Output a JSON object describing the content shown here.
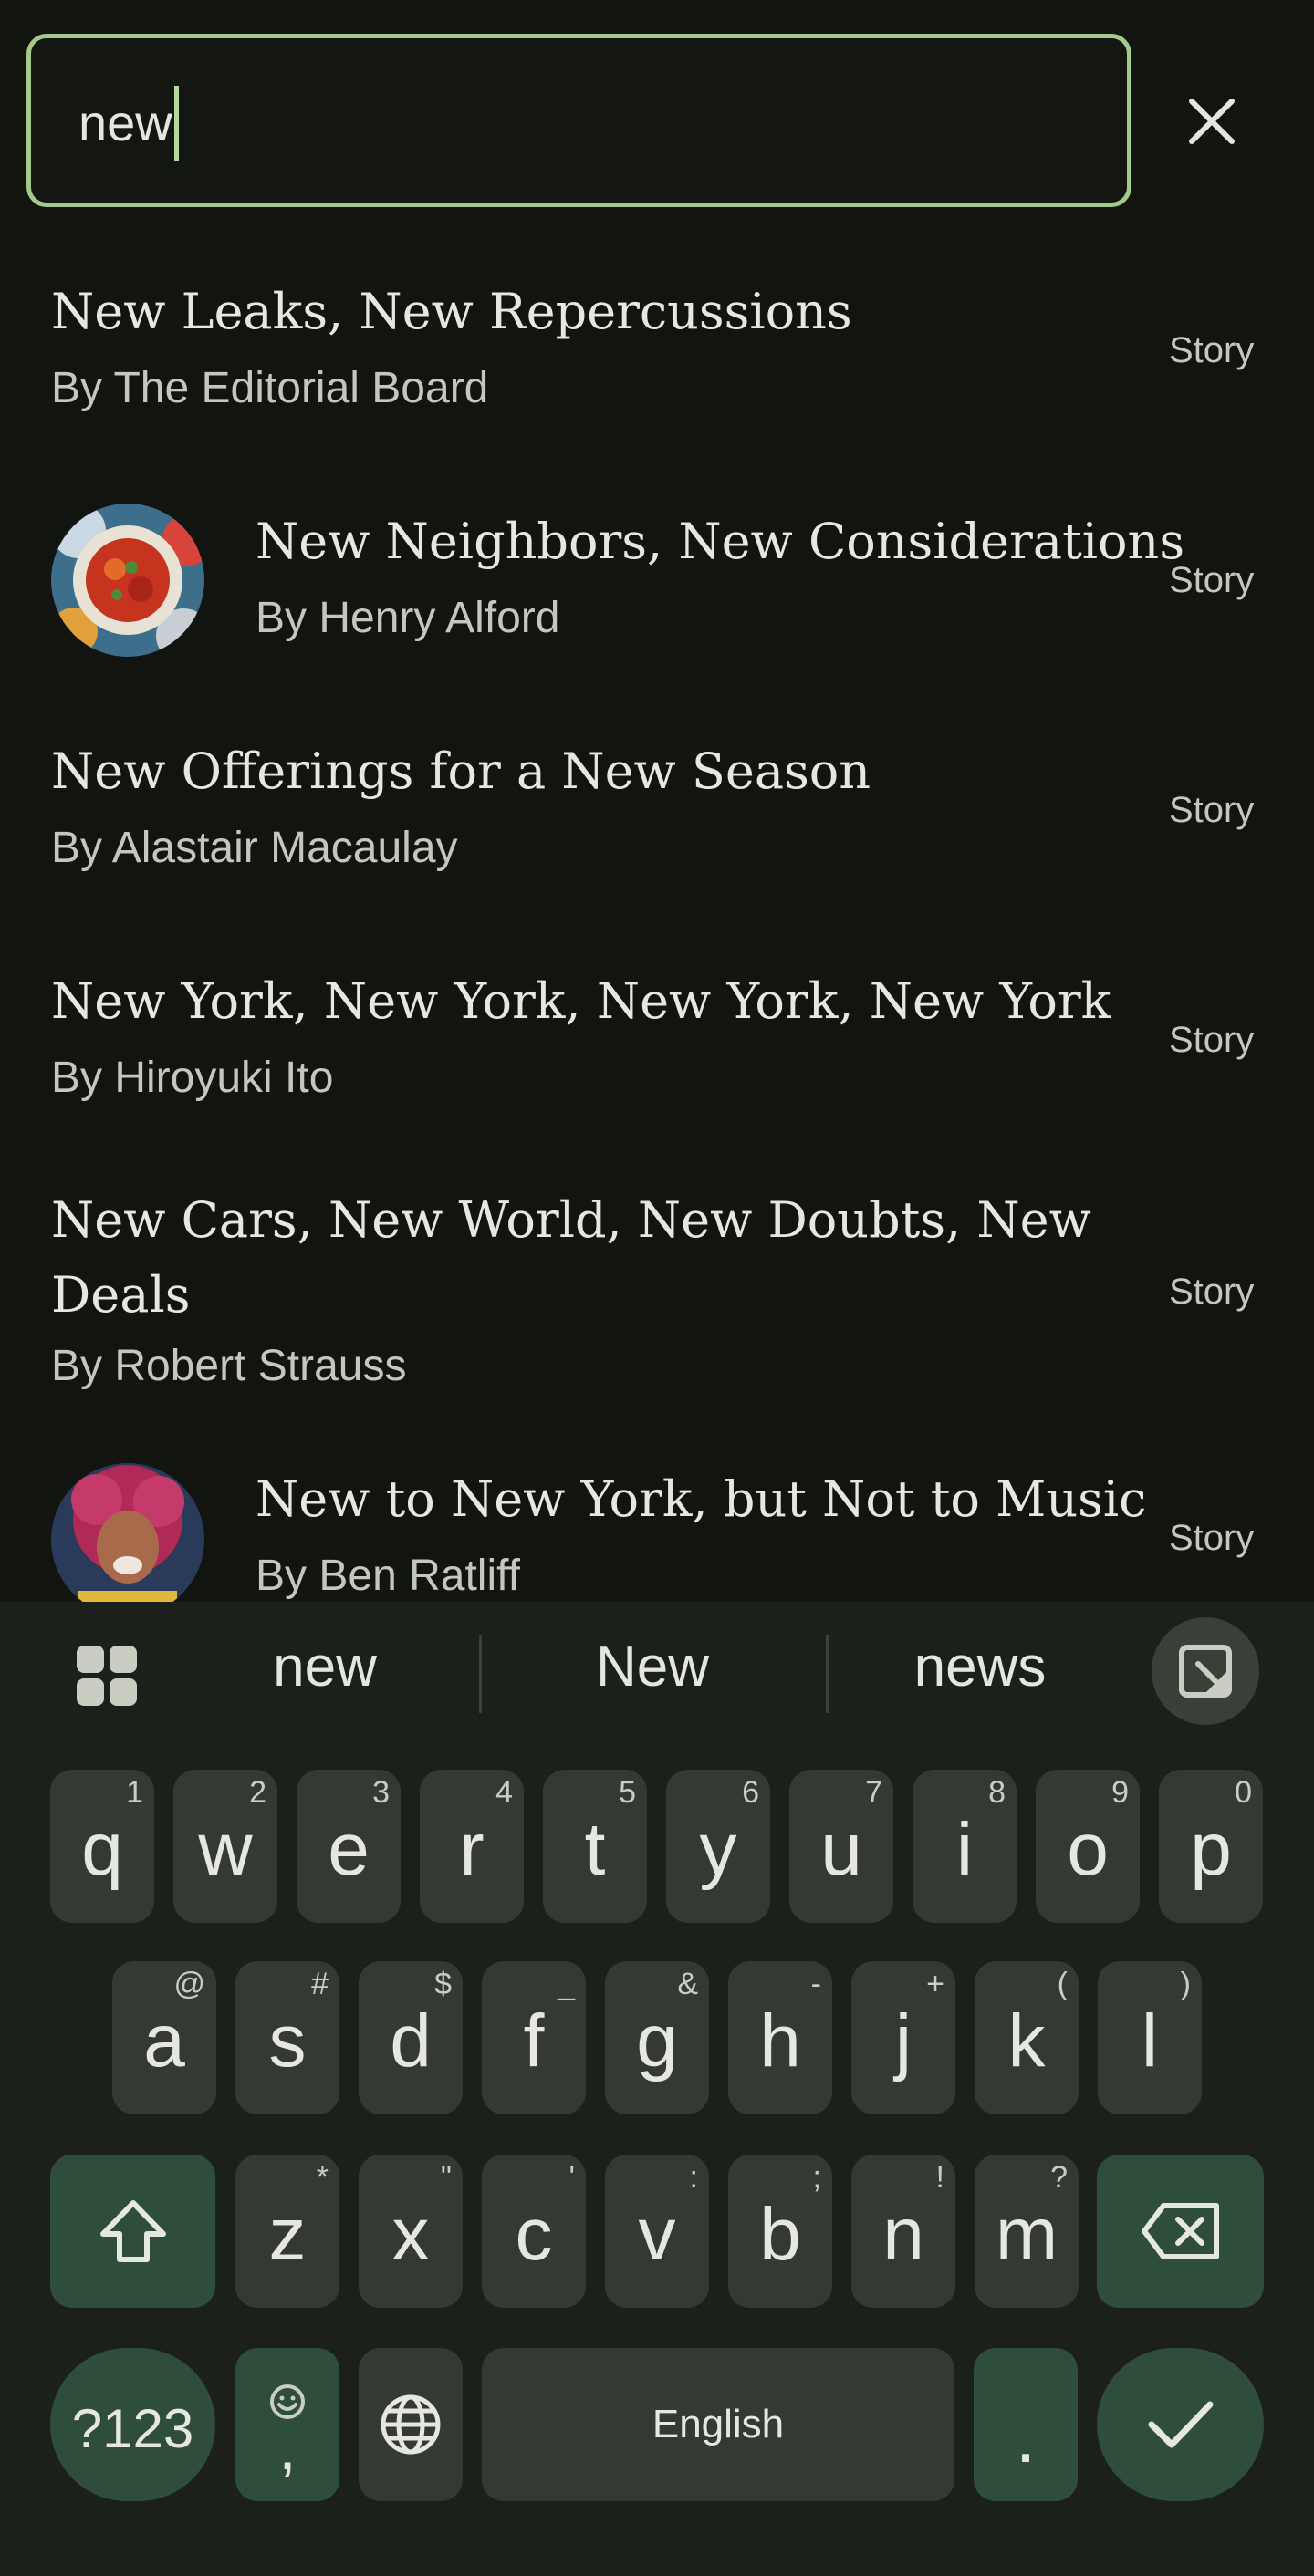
{
  "search": {
    "value": "new"
  },
  "results": [
    {
      "title": "New Leaks, New Repercussions",
      "byline": "By The Editorial Board",
      "type": "Story"
    },
    {
      "title": "New Neighbors, New Considerations",
      "byline": "By Henry Alford",
      "type": "Story"
    },
    {
      "title": "New Offerings for a New Season",
      "byline": "By Alastair Macaulay",
      "type": "Story"
    },
    {
      "title": "New York, New York, New York, New York",
      "byline": "By Hiroyuki Ito",
      "type": "Story"
    },
    {
      "title_line1": "New Cars, New World, New Doubts, New",
      "title_line2": "Deals",
      "byline": "By Robert Strauss",
      "type": "Story"
    },
    {
      "title": "New to New York, but Not to Music",
      "byline": "By Ben Ratliff",
      "type": "Story"
    }
  ],
  "keyboard": {
    "suggestions": [
      "new",
      "New",
      "news"
    ],
    "row1": [
      {
        "k": "q",
        "h": "1"
      },
      {
        "k": "w",
        "h": "2"
      },
      {
        "k": "e",
        "h": "3"
      },
      {
        "k": "r",
        "h": "4"
      },
      {
        "k": "t",
        "h": "5"
      },
      {
        "k": "y",
        "h": "6"
      },
      {
        "k": "u",
        "h": "7"
      },
      {
        "k": "i",
        "h": "8"
      },
      {
        "k": "o",
        "h": "9"
      },
      {
        "k": "p",
        "h": "0"
      }
    ],
    "row2": [
      {
        "k": "a",
        "h": "@"
      },
      {
        "k": "s",
        "h": "#"
      },
      {
        "k": "d",
        "h": "$"
      },
      {
        "k": "f",
        "h": "_"
      },
      {
        "k": "g",
        "h": "&"
      },
      {
        "k": "h",
        "h": "-"
      },
      {
        "k": "j",
        "h": "+"
      },
      {
        "k": "k",
        "h": "("
      },
      {
        "k": "l",
        "h": ")"
      }
    ],
    "row3": [
      {
        "k": "z",
        "h": "*"
      },
      {
        "k": "x",
        "h": "\""
      },
      {
        "k": "c",
        "h": "'"
      },
      {
        "k": "v",
        "h": ":"
      },
      {
        "k": "b",
        "h": ";"
      },
      {
        "k": "n",
        "h": "!"
      },
      {
        "k": "m",
        "h": "?"
      }
    ],
    "symbols_label": "?123",
    "comma_label": ",",
    "space_label": "English",
    "period_label": ".",
    "colors": {
      "accent": "#a5c98a",
      "key": "#343a33",
      "action_key": "#2e4d3a"
    }
  }
}
